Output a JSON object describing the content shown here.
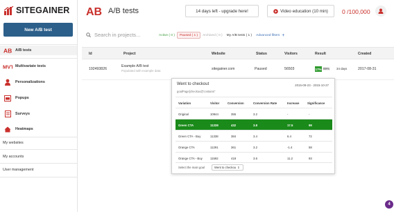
{
  "brand": {
    "name": "SITEGAINER"
  },
  "sidebar": {
    "new_button": "New A/B test",
    "items": [
      {
        "label": "A/B tests",
        "icon": "ab-icon"
      },
      {
        "label": "Multivariate tests",
        "icon": "mvt-icon"
      },
      {
        "label": "Personalizations",
        "icon": "personalization-icon"
      },
      {
        "label": "Popups",
        "icon": "popup-icon"
      },
      {
        "label": "Surveys",
        "icon": "survey-icon"
      },
      {
        "label": "Heatmaps",
        "icon": "heatmap-icon"
      },
      {
        "label": "My websites"
      },
      {
        "label": "My accounts"
      },
      {
        "label": "User management"
      }
    ]
  },
  "header": {
    "title": "A/B tests",
    "trial_button": "14 days left - upgrade here!",
    "video_button": "Video education (10 min)",
    "quota": "0 /100,000"
  },
  "search": {
    "placeholder": "Search in projects..."
  },
  "filters": {
    "active": "Active ( 0 )",
    "paused": "Paused ( 1 )",
    "archived": "Archived ( 0 )",
    "my_tests": "My A/B tests ( 1 )",
    "advanced": "Advanced filters"
  },
  "table": {
    "columns": [
      "Id",
      "Project",
      "Website",
      "Status",
      "Visitors",
      "Result",
      "Created"
    ],
    "row": {
      "id": "192493826",
      "project": "Example A/B test",
      "project_sub": "Populated with example data",
      "website": "sitegainer.com",
      "status": "Paused",
      "visitors": "56503",
      "result_pct": "17%",
      "result_sig": "99%",
      "result_days": "34 days",
      "created": "2017-08-31"
    }
  },
  "popup": {
    "title": "Went to checkout",
    "dates": "2015-09-23 - 2015-10-27",
    "goal": "goalPage[checkout]\"contains\"",
    "columns": [
      "Variation",
      "Visitor",
      "Conversion",
      "Conversion Rate",
      "Increase",
      "Significance"
    ],
    "rows": [
      {
        "variation": "Original",
        "visitor": "10944",
        "conversion": "355",
        "rate": "3.2",
        "increase": "-",
        "significance": "-",
        "winner": false
      },
      {
        "variation": "Green CTA",
        "visitor": "11338",
        "conversion": "432",
        "rate": "3.8",
        "increase": "17.5",
        "significance": "99",
        "winner": true
      },
      {
        "variation": "Green CTA - Buy",
        "visitor": "11338",
        "conversion": "384",
        "rate": "3.4",
        "increase": "6.4",
        "significance": "72",
        "winner": false
      },
      {
        "variation": "Orange CTA",
        "visitor": "11291",
        "conversion": "361",
        "rate": "3.2",
        "increase": "-1.4",
        "significance": "58",
        "winner": false
      },
      {
        "variation": "Orange CTA - Buy",
        "visitor": "11592",
        "conversion": "418",
        "rate": "3.6",
        "increase": "11.2",
        "significance": "93",
        "winner": false
      }
    ],
    "footer_label": "Select the main goal",
    "footer_select": "Went to checkou"
  },
  "help_badge": "4",
  "colors": {
    "brand_red": "#c9302c",
    "button_blue": "#2c5f8a",
    "winner_green": "#1a8a1a"
  }
}
